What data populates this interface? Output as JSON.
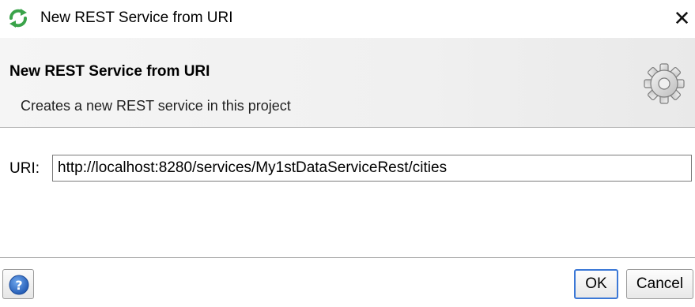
{
  "window": {
    "title": "New REST Service from URI",
    "icon": "soapui-refresh-icon",
    "close_label": "✕"
  },
  "banner": {
    "title": "New REST Service from URI",
    "description": "Creates a new REST service in this project",
    "icon": "gear-icon"
  },
  "form": {
    "uri_label": "URI:",
    "uri_value": "http://localhost:8280/services/My1stDataServiceRest/cities"
  },
  "footer": {
    "help_icon": "help-icon",
    "ok_label": "OK",
    "cancel_label": "Cancel"
  },
  "colors": {
    "icon_green": "#3aa34a",
    "focus_blue": "#3b78d6",
    "help_blue": "#2f6fc9"
  }
}
